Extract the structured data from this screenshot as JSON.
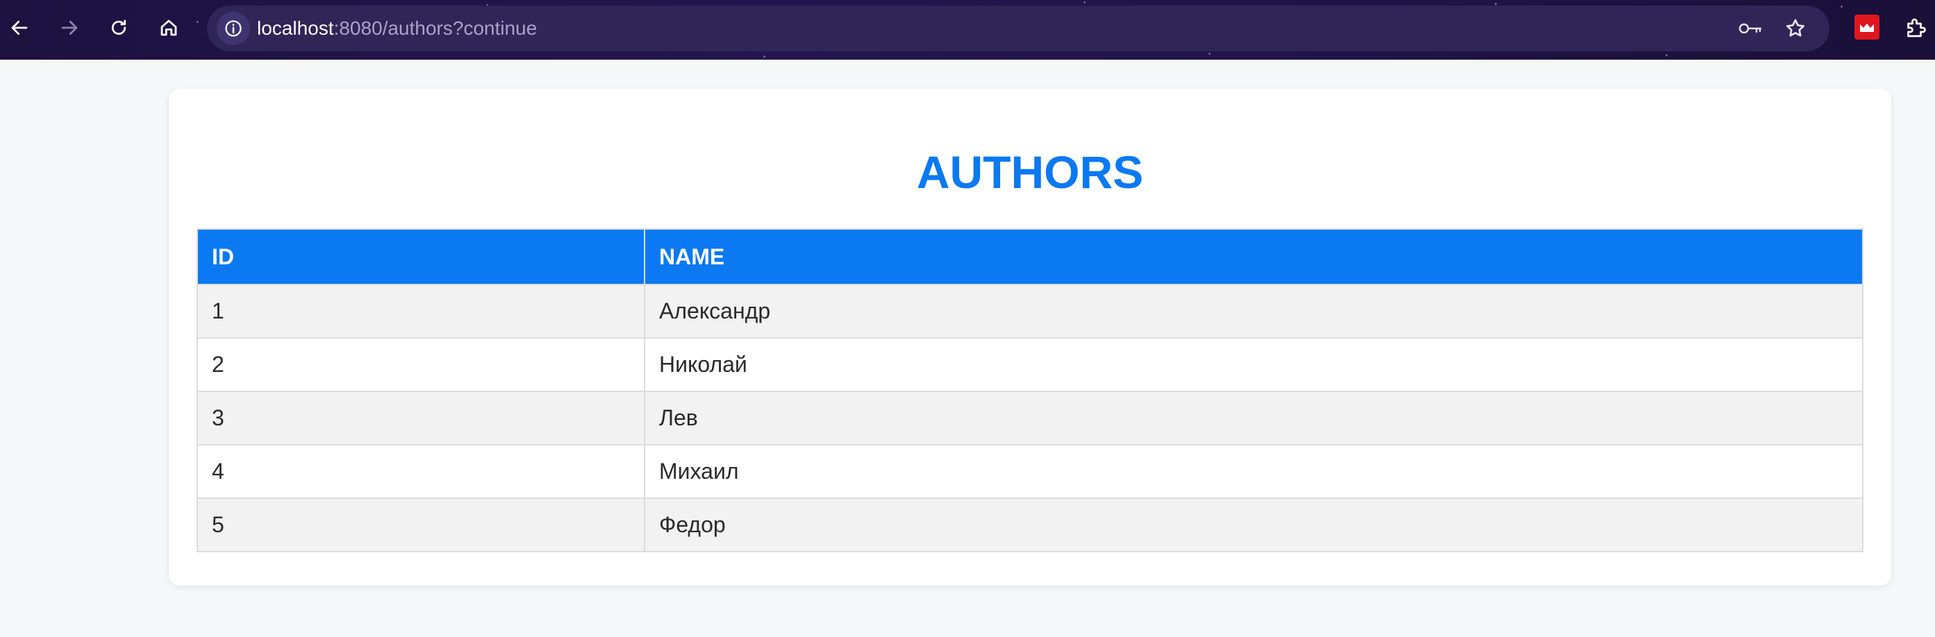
{
  "browser": {
    "url_host": "localhost",
    "url_rest": ":8080/authors?continue",
    "icons": {
      "back": "arrow-left-icon",
      "forward": "arrow-right-icon",
      "reload": "reload-icon",
      "home": "home-icon",
      "site_info": "info-icon",
      "passwords": "key-icon",
      "bookmark": "star-icon",
      "extension": "extension-icon",
      "extensions_menu": "puzzle-icon"
    }
  },
  "page": {
    "title": "AUTHORS",
    "accent_color": "#0a79f2"
  },
  "table": {
    "columns": [
      "ID",
      "NAME"
    ],
    "rows": [
      {
        "id": "1",
        "name": "Александр"
      },
      {
        "id": "2",
        "name": "Николай"
      },
      {
        "id": "3",
        "name": "Лев"
      },
      {
        "id": "4",
        "name": "Михаил"
      },
      {
        "id": "5",
        "name": "Федор"
      }
    ]
  }
}
